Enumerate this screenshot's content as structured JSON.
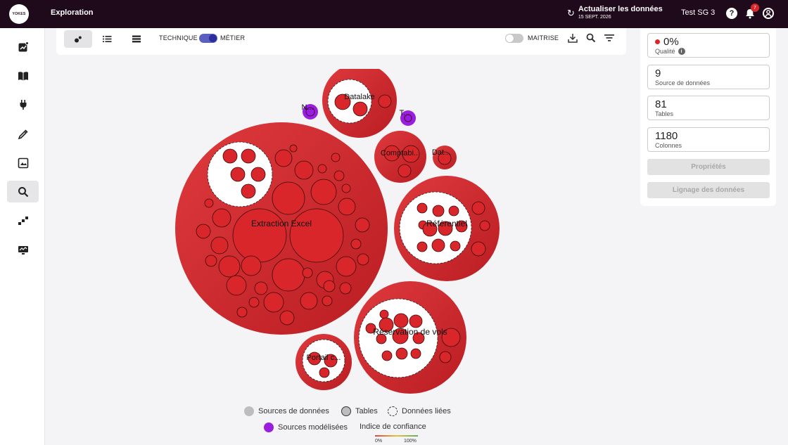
{
  "header": {
    "logo_text": "YOKES",
    "title": "Exploration",
    "refresh_title": "Actualiser les données",
    "refresh_date": "15 SEPT. 2026",
    "user_name": "Test SG 3",
    "notification_count": "7",
    "help_symbol": "?"
  },
  "sidebar": {
    "items": [
      {
        "icon": "chart-icon"
      },
      {
        "icon": "book-icon"
      },
      {
        "icon": "plug-icon"
      },
      {
        "icon": "pipette-icon"
      },
      {
        "icon": "image-icon"
      },
      {
        "icon": "search-icon",
        "active": true
      },
      {
        "icon": "lineage-icon"
      },
      {
        "icon": "monitor-icon"
      }
    ]
  },
  "toolbar": {
    "label_technique": "TECHNIQUE",
    "label_metier": "MÉTIER",
    "label_maitrise": "MAITRISE",
    "metier_toggle_on": true,
    "maitrise_toggle_on": false
  },
  "stats": {
    "quality_value": "0%",
    "quality_label": "Qualité",
    "sources_value": "9",
    "sources_label": "Source de données",
    "tables_value": "81",
    "tables_label": "Tables",
    "columns_value": "1180",
    "columns_label": "Colonnes"
  },
  "actions": {
    "properties": "Propriétés",
    "lineage": "Lignage des données"
  },
  "bubbles": [
    {
      "id": "extraction",
      "label": "Extraction Excel",
      "type": "source"
    },
    {
      "id": "datalake",
      "label": "Datalake",
      "type": "source"
    },
    {
      "id": "comptabi",
      "label": "Comptabi...",
      "type": "source"
    },
    {
      "id": "dat",
      "label": "Dat...",
      "type": "source"
    },
    {
      "id": "referentiel",
      "label": "Référentiel",
      "type": "source"
    },
    {
      "id": "reservation",
      "label": "Réservation de vols",
      "type": "source"
    },
    {
      "id": "portail",
      "label": "Portail c...",
      "type": "source"
    },
    {
      "id": "modeled1",
      "label": "N...",
      "type": "modeled"
    },
    {
      "id": "modeled2",
      "label": "T...",
      "type": "modeled"
    }
  ],
  "legend": {
    "sources": "Sources de données",
    "tables": "Tables",
    "linked": "Données liées",
    "modeled": "Sources modélisées",
    "confidence": "Indice de confiance",
    "scale_min": "0%",
    "scale_max": "100%"
  },
  "colors": {
    "source": "#d9262b",
    "modeled": "#9a1ee0",
    "topbar": "#1e0a1a",
    "toggle_on": "#2b2f9e"
  }
}
